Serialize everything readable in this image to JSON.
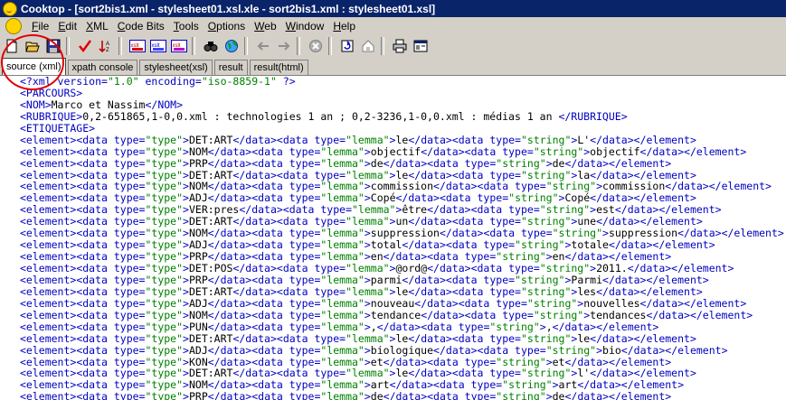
{
  "window": {
    "title": "Cooktop - [sort2bis1.xml - stylesheet01.xsl.xle - sort2bis1.xml : stylesheet01.xsl]"
  },
  "menu": {
    "items": [
      "File",
      "Edit",
      "XML",
      "Code Bits",
      "Tools",
      "Options",
      "Web",
      "Window",
      "Help"
    ]
  },
  "toolbar": {
    "buttons": [
      {
        "name": "new-icon"
      },
      {
        "name": "open-icon"
      },
      {
        "name": "save-icon"
      },
      {
        "name": "validate-icon"
      },
      {
        "name": "sort-icon"
      },
      {
        "name": "xslt-run-icon"
      },
      {
        "name": "xslt-output-icon"
      },
      {
        "name": "xslt-debug-icon"
      },
      {
        "name": "find-icon"
      },
      {
        "name": "browser-icon"
      },
      {
        "name": "back-icon"
      },
      {
        "name": "forward-icon"
      },
      {
        "name": "stop-icon"
      },
      {
        "name": "refresh-icon"
      },
      {
        "name": "home-icon"
      },
      {
        "name": "print-icon"
      },
      {
        "name": "properties-icon"
      }
    ],
    "badge": "xslt"
  },
  "tabs": [
    "source (xml)",
    "xpath console",
    "stylesheet(xsl)",
    "result",
    "result(html)"
  ],
  "active_tab": "source (xml)",
  "code_lines": [
    "<?xml version=\"1.0\" encoding=\"iso-8859-1\" ?>",
    "<PARCOURS>",
    "<NOM>Marco et Nassim</NOM>",
    "<RUBRIQUE>0,2-651865,1-0,0.xml : technologies 1 an ; 0,2-3236,1-0,0.xml : médias 1 an </RUBRIQUE>",
    "<ETIQUETAGE>",
    "<element><data type=\"type\">DET:ART</data><data type=\"lemma\">le</data><data type=\"string\">L'</data></element>",
    "<element><data type=\"type\">NOM</data><data type=\"lemma\">objectif</data><data type=\"string\">objectif</data></element>",
    "<element><data type=\"type\">PRP</data><data type=\"lemma\">de</data><data type=\"string\">de</data></element>",
    "<element><data type=\"type\">DET:ART</data><data type=\"lemma\">le</data><data type=\"string\">la</data></element>",
    "<element><data type=\"type\">NOM</data><data type=\"lemma\">commission</data><data type=\"string\">commission</data></element>",
    "<element><data type=\"type\">ADJ</data><data type=\"lemma\">Copé</data><data type=\"string\">Copé</data></element>",
    "<element><data type=\"type\">VER:pres</data><data type=\"lemma\">être</data><data type=\"string\">est</data></element>",
    "<element><data type=\"type\">DET:ART</data><data type=\"lemma\">un</data><data type=\"string\">une</data></element>",
    "<element><data type=\"type\">NOM</data><data type=\"lemma\">suppression</data><data type=\"string\">suppression</data></element>",
    "<element><data type=\"type\">ADJ</data><data type=\"lemma\">total</data><data type=\"string\">totale</data></element>",
    "<element><data type=\"type\">PRP</data><data type=\"lemma\">en</data><data type=\"string\">en</data></element>",
    "<element><data type=\"type\">DET:POS</data><data type=\"lemma\">@ord@</data><data type=\"string\">2011.</data></element>",
    "<element><data type=\"type\">PRP</data><data type=\"lemma\">parmi</data><data type=\"string\">Parmi</data></element>",
    "<element><data type=\"type\">DET:ART</data><data type=\"lemma\">le</data><data type=\"string\">les</data></element>",
    "<element><data type=\"type\">ADJ</data><data type=\"lemma\">nouveau</data><data type=\"string\">nouvelles</data></element>",
    "<element><data type=\"type\">NOM</data><data type=\"lemma\">tendance</data><data type=\"string\">tendances</data></element>",
    "<element><data type=\"type\">PUN</data><data type=\"lemma\">,</data><data type=\"string\">,</data></element>",
    "<element><data type=\"type\">DET:ART</data><data type=\"lemma\">le</data><data type=\"string\">le</data></element>",
    "<element><data type=\"type\">ADJ</data><data type=\"lemma\">biologique</data><data type=\"string\">bio</data></element>",
    "<element><data type=\"type\">KON</data><data type=\"lemma\">et</data><data type=\"string\">et</data></element>",
    "<element><data type=\"type\">DET:ART</data><data type=\"lemma\">le</data><data type=\"string\">l'</data></element>",
    "<element><data type=\"type\">NOM</data><data type=\"lemma\">art</data><data type=\"string\">art</data></element>",
    "<element><data type=\"type\">PRP</data><data type=\"lemma\">de</data><data type=\"string\">de</data></element>"
  ],
  "colors": {
    "tag": "#0000c0",
    "string": "#008000",
    "titlebar": "#0a246a",
    "annotation_circle": "#e00000"
  }
}
